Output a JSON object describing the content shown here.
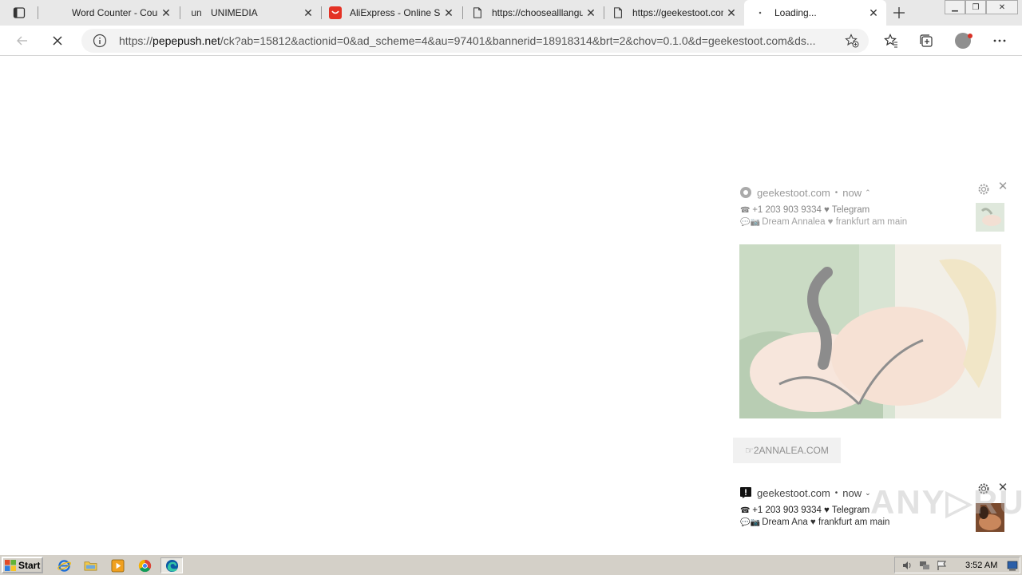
{
  "tabs": [
    {
      "title": "Word Counter - Count Words & Correct Writing",
      "favicon": "blank-icon"
    },
    {
      "title": "UNIMEDIA",
      "favicon": "un"
    },
    {
      "title": "AliExpress - Online Shopping for Popular Electronics",
      "favicon": "aliexpress-icon"
    },
    {
      "title": "https://choosealllanguages.com",
      "favicon": "page-icon"
    },
    {
      "title": "https://geekestoot.com",
      "favicon": "page-icon"
    },
    {
      "title": "Loading...",
      "favicon": "loading-icon"
    }
  ],
  "address_bar": {
    "url_prefix": "https://",
    "url_host": "pepepush.net",
    "url_rest": "/ck?ab=15812&actionid=0&ad_scheme=4&au=97401&bannerid=18918314&brt=2&chov=0.1.0&d=geekestoot.com&ds..."
  },
  "notifications": [
    {
      "source": "geekestoot.com",
      "time": "now",
      "line1_icon": "☎",
      "line1": "+1 203 903 9334 ♥ Telegram",
      "line2_icon": "💬📷",
      "line2": "Dream Annalea ♥ frankfurt am main",
      "action_label": "☞2ANNALEA.COM"
    },
    {
      "source": "geekestoot.com",
      "time": "now",
      "line1_icon": "☎",
      "line1": "+1 203 903 9334 ♥ Telegram",
      "line2_icon": "💬📷",
      "line2": "Dream Ana ♥ frankfurt am main"
    }
  ],
  "taskbar": {
    "start_label": "Start",
    "clock": "3:52 AM"
  },
  "colors": {
    "tabstrip_bg": "#e8e8e8",
    "omnibox_bg": "#f3f3f3",
    "taskbar_bg": "#d4d0c8",
    "aliexpress_red": "#e43225",
    "edge_blue": "#0c59a4"
  }
}
